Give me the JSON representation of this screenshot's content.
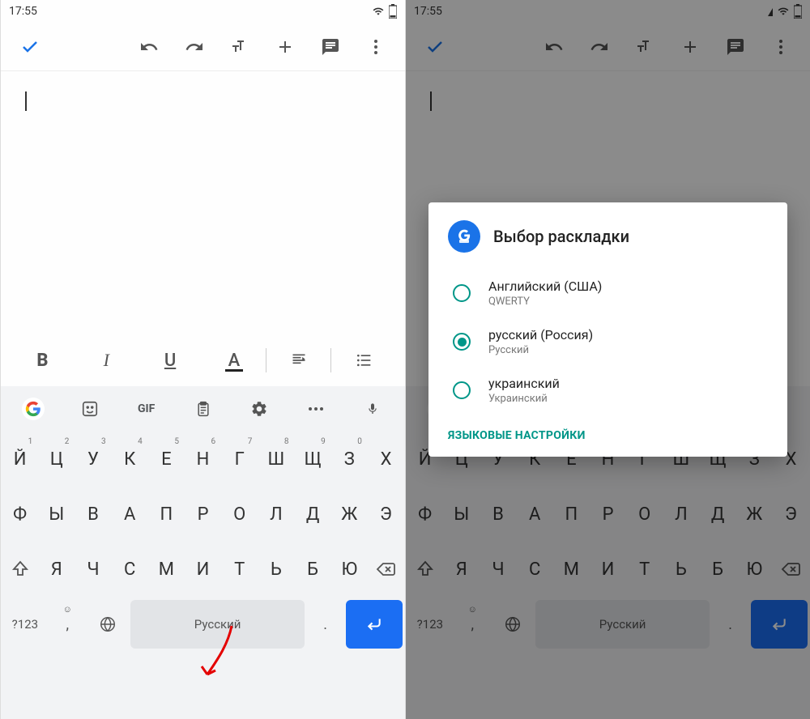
{
  "status": {
    "time": "17:55"
  },
  "editor": {
    "content": ""
  },
  "format": {
    "bold": "B",
    "italic": "I",
    "underline": "U",
    "color": "A"
  },
  "kb_top": {
    "gif": "GIF"
  },
  "keyboard": {
    "row1": [
      {
        "k": "Й",
        "n": "1"
      },
      {
        "k": "Ц",
        "n": "2"
      },
      {
        "k": "У",
        "n": "3"
      },
      {
        "k": "К",
        "n": "4"
      },
      {
        "k": "Е",
        "n": "5"
      },
      {
        "k": "Н",
        "n": "6"
      },
      {
        "k": "Г",
        "n": "7"
      },
      {
        "k": "Ш",
        "n": "8"
      },
      {
        "k": "Щ",
        "n": "9"
      },
      {
        "k": "З",
        "n": "0"
      },
      {
        "k": "Х",
        "n": ""
      }
    ],
    "row2": [
      "Ф",
      "Ы",
      "В",
      "А",
      "П",
      "Р",
      "О",
      "Л",
      "Д",
      "Ж",
      "Э"
    ],
    "row3": [
      "Я",
      "Ч",
      "С",
      "М",
      "И",
      "Т",
      "Ь",
      "Б",
      "Ю"
    ],
    "sym": "?123",
    "comma": ",",
    "space": "Русский",
    "period": "."
  },
  "dialog": {
    "title": "Выбор раскладки",
    "options": [
      {
        "title": "Английский (США)",
        "sub": "QWERTY",
        "checked": false
      },
      {
        "title": "русский (Россия)",
        "sub": "Русский",
        "checked": true
      },
      {
        "title": "украинский",
        "sub": "Украинский",
        "checked": false
      }
    ],
    "link": "ЯЗЫКОВЫЕ НАСТРОЙКИ"
  }
}
